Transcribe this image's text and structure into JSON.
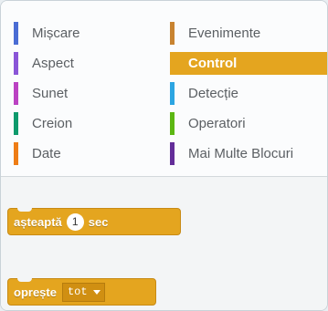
{
  "categories": {
    "left": [
      {
        "label": "Mișcare",
        "color": "#4a6cd4"
      },
      {
        "label": "Aspect",
        "color": "#8a55d7"
      },
      {
        "label": "Sunet",
        "color": "#bb42c3"
      },
      {
        "label": "Creion",
        "color": "#0e9a6c"
      },
      {
        "label": "Date",
        "color": "#ee7d16"
      }
    ],
    "right": [
      {
        "label": "Evenimente",
        "color": "#c88330"
      },
      {
        "label": "Control",
        "color": "#e1a91a",
        "selected": true
      },
      {
        "label": "Detecție",
        "color": "#2ca5e2"
      },
      {
        "label": "Operatori",
        "color": "#5cb712"
      },
      {
        "label": "Mai Multe Blocuri",
        "color": "#632d99"
      }
    ]
  },
  "blocks": {
    "wait": {
      "label": "așteaptă",
      "value": "1",
      "unit": "sec"
    },
    "stop": {
      "label": "oprește",
      "option": "tot"
    }
  }
}
